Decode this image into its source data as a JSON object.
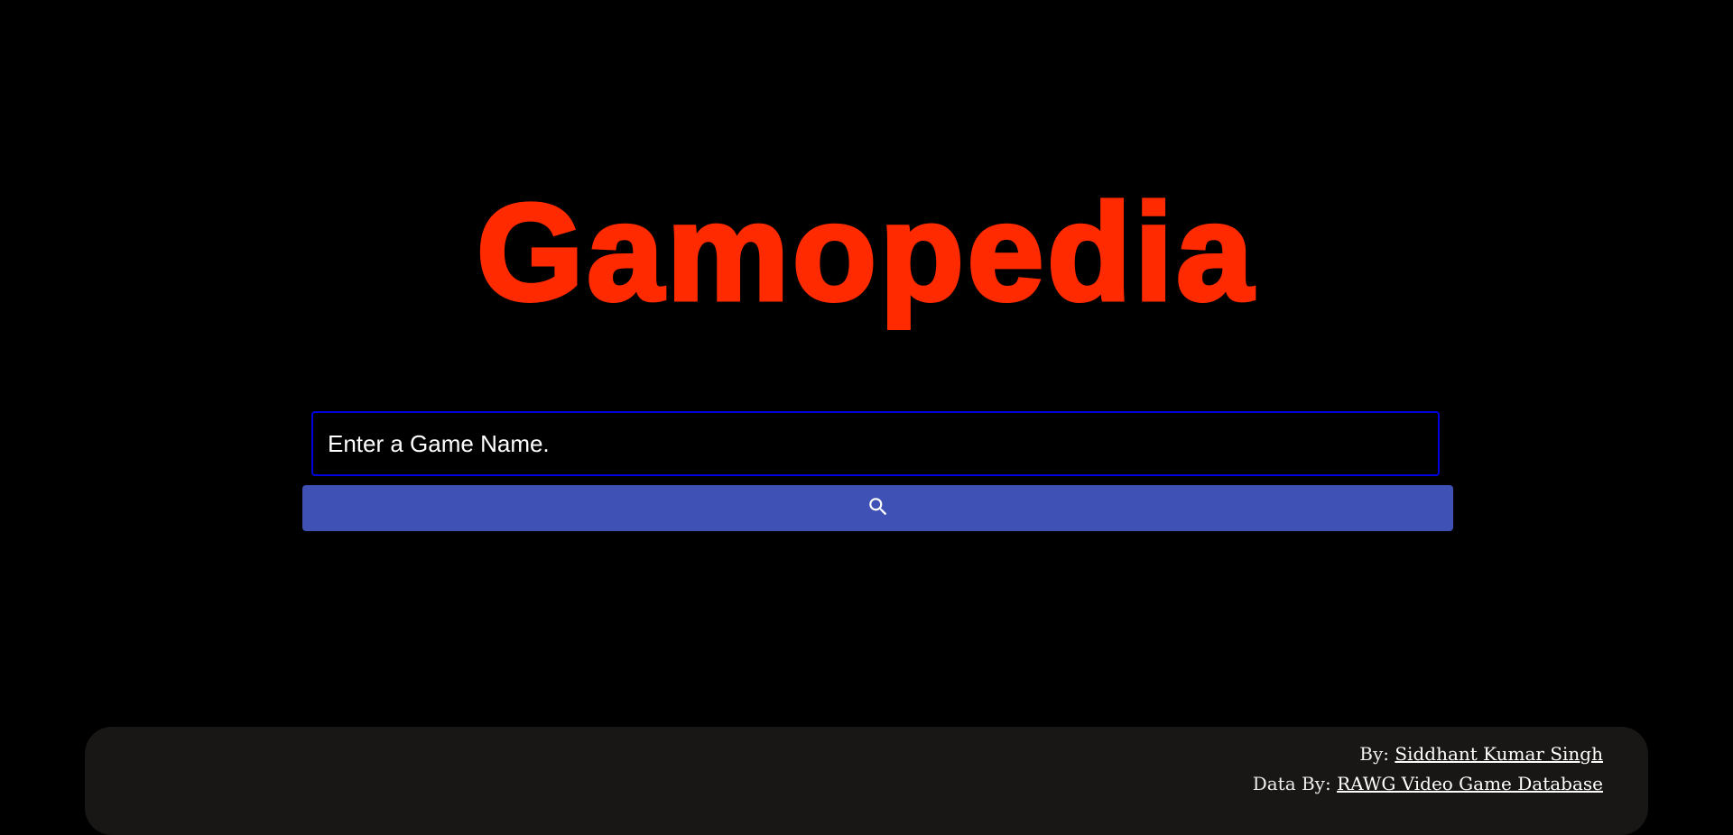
{
  "header": {
    "title": "Gamopedia",
    "accent_color": "#ff2a00"
  },
  "search": {
    "placeholder": "Enter a Game Name.",
    "value": "",
    "button_icon": "search-icon",
    "button_color": "#3f51b5"
  },
  "footer": {
    "by_label": "By:",
    "author": "Siddhant Kumar Singh",
    "data_by_label": "Data By:",
    "data_source": "RAWG Video Game Database"
  }
}
